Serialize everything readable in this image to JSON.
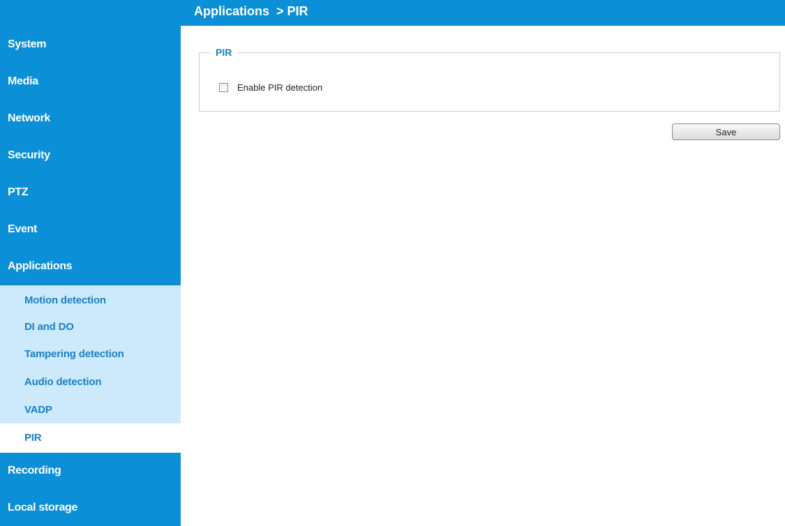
{
  "header": {
    "breadcrumb": "Applications  > PIR"
  },
  "sidebar": {
    "items": [
      {
        "label": "System"
      },
      {
        "label": "Media"
      },
      {
        "label": "Network"
      },
      {
        "label": "Security"
      },
      {
        "label": "PTZ"
      },
      {
        "label": "Event"
      },
      {
        "label": "Applications"
      }
    ],
    "submenu": [
      {
        "label": "Motion detection"
      },
      {
        "label": "DI and DO"
      },
      {
        "label": "Tampering detection"
      },
      {
        "label": "Audio detection"
      },
      {
        "label": "VADP"
      },
      {
        "label": "PIR",
        "active": true
      }
    ],
    "bottom_items": [
      {
        "label": "Recording"
      },
      {
        "label": "Local storage"
      }
    ]
  },
  "pir": {
    "legend": "PIR",
    "checkbox_label": "Enable PIR detection",
    "checked": false
  },
  "actions": {
    "save_label": "Save"
  },
  "colors": {
    "primary": "#0b8fd6",
    "submenu_bg": "#cceafb",
    "accent_text": "#1a7fc5"
  }
}
